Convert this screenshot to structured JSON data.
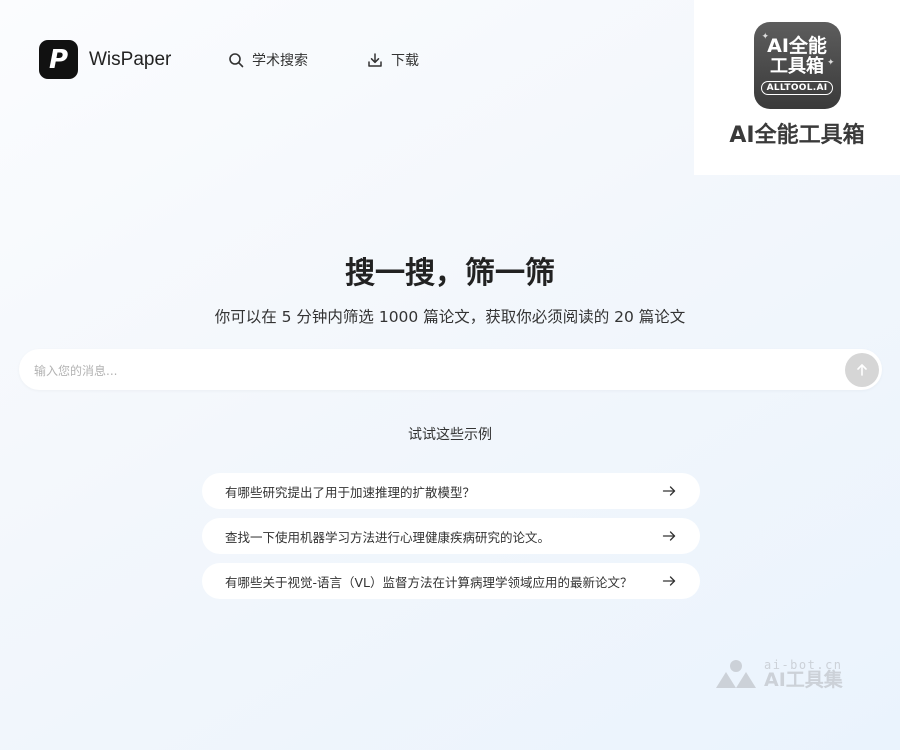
{
  "header": {
    "logo_mark": "P",
    "brand_name": "WisPaper",
    "nav": [
      {
        "label": "学术搜索",
        "icon": "search-icon"
      },
      {
        "label": "下载",
        "icon": "download-icon"
      }
    ]
  },
  "badge": {
    "line1": "AI全能",
    "line2": "工具箱",
    "pill": "ALLTOOL.AI",
    "caption": "AI全能工具箱"
  },
  "hero": {
    "title": "搜一搜，筛一筛",
    "subtitle": "你可以在 5 分钟内筛选 1000 篇论文，获取你必须阅读的 20 篇论文"
  },
  "search": {
    "placeholder": "输入您的消息...",
    "value": ""
  },
  "examples": {
    "title": "试试这些示例",
    "items": [
      {
        "text": "有哪些研究提出了用于加速推理的扩散模型？"
      },
      {
        "text": "查找一下使用机器学习方法进行心理健康疾病研究的论文。"
      },
      {
        "text": "有哪些关于视觉-语言（VL）监督方法在计算病理学领域应用的最新论文？"
      }
    ]
  },
  "watermark": {
    "url": "ai-bot.cn",
    "name": "AI工具集"
  },
  "colors": {
    "accent": "#111111",
    "send_button": "#d6d6d6",
    "background_tint": "#eaf3fd"
  }
}
